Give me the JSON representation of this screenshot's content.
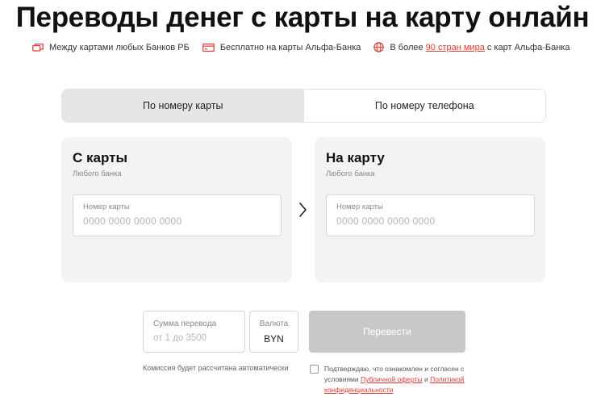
{
  "page_title": "Переводы денег с карты на карту онлайн",
  "features": {
    "f1": "Между картами любых Банков РБ",
    "f2": "Бесплатно на карты Альфа-Банка",
    "f3_pre": "В более ",
    "f3_link": "90 стран мира",
    "f3_post": " с карт Альфа-Банка"
  },
  "tabs": {
    "by_card": "По номеру карты",
    "by_phone": "По номеру телефона"
  },
  "from_card": {
    "title": "С карты",
    "subtitle": "Любого банка",
    "input_label": "Номер карты",
    "placeholder": "0000 0000 0000 0000"
  },
  "to_card": {
    "title": "На карту",
    "subtitle": "Любого банка",
    "input_label": "Номер карты",
    "placeholder": "0000 0000 0000 0000"
  },
  "amount": {
    "label": "Сумма перевода",
    "placeholder": "от 1 до 3500"
  },
  "currency": {
    "label": "Валюта",
    "value": "BYN"
  },
  "submit_label": "Перевести",
  "commission_note": "Комиссия будет рассчитана автоматически",
  "consent": {
    "pre": "Подтверждаю, что ознакомлен и согласен с условиями ",
    "offer_link": "Публичной оферты",
    "mid": " и ",
    "privacy_link": "Политикой конфиденциальности"
  },
  "colors": {
    "accent": "#e03a33",
    "tab_active_bg": "#e6e6e6",
    "card_bg": "#f3f3f3",
    "button_disabled": "#c8c8c8"
  },
  "icons": {
    "f1": "cards-icon",
    "f2": "card-icon",
    "f3": "globe-icon",
    "arrow": "chevron-right-icon"
  }
}
